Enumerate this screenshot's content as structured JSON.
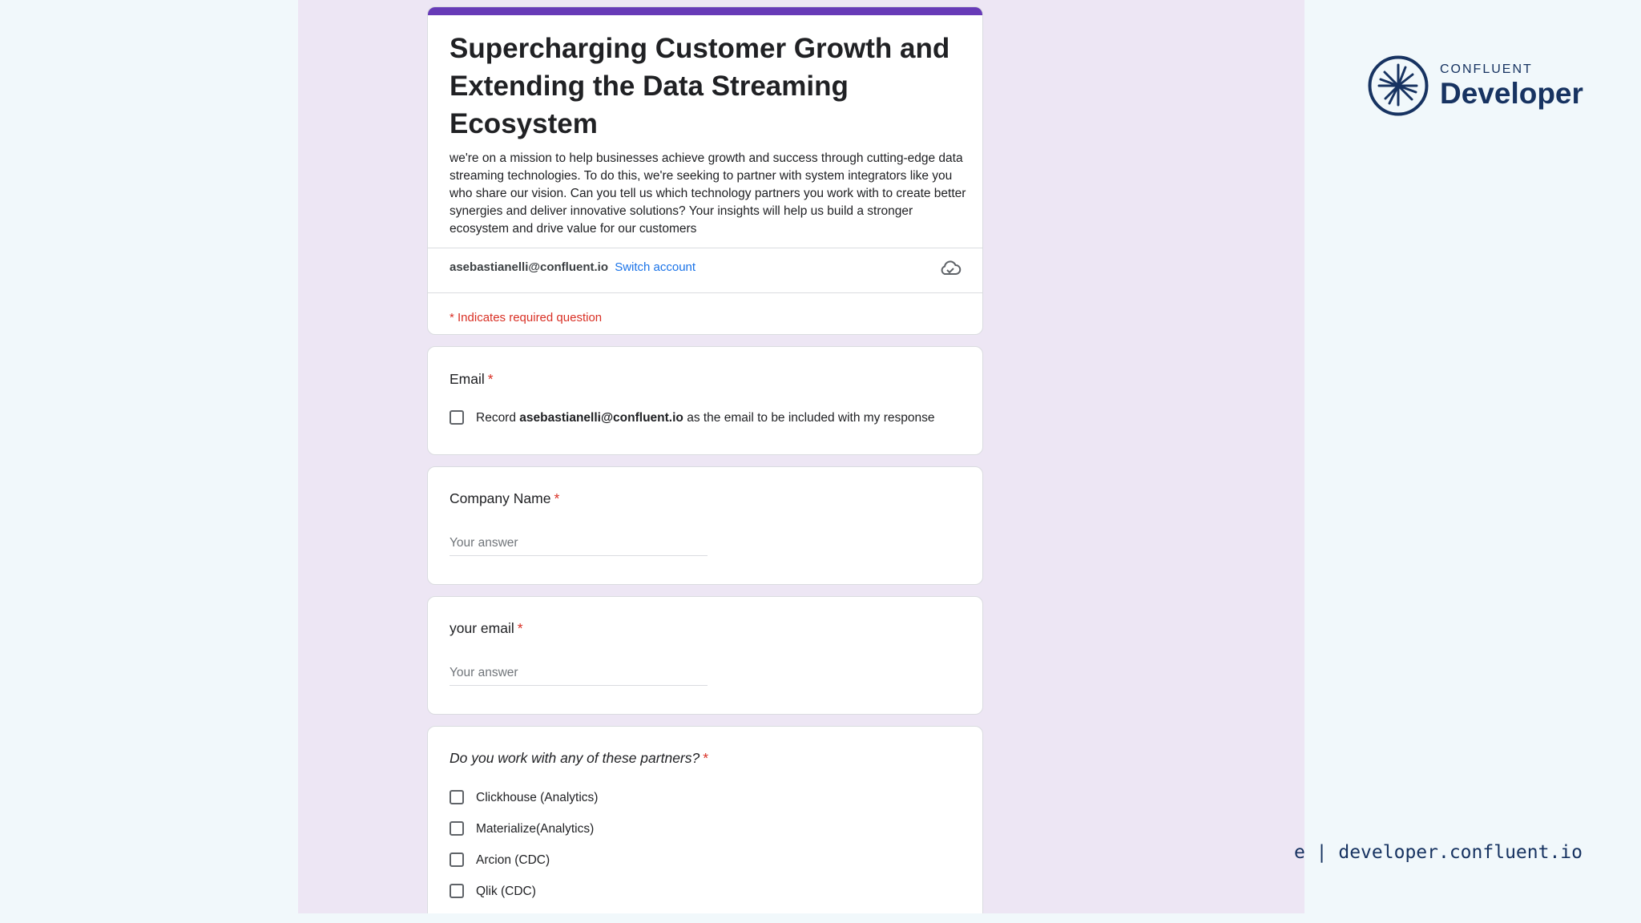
{
  "form": {
    "title": "Supercharging Customer Growth and Extending the Data Streaming Ecosystem",
    "description": "we're on a mission to help businesses achieve growth and success through cutting-edge data streaming technologies. To do this, we're seeking to partner with system integrators like you who share our vision. Can you tell us which technology partners you work with to create better synergies and deliver innovative solutions? Your insights will help us build a stronger ecosystem and drive value for our customers",
    "account_email": "asebastianelli@confluent.io",
    "switch_account": "Switch account",
    "required_note": "* Indicates required question",
    "accent_color": "#673ab7"
  },
  "questions": {
    "email": {
      "label": "Email",
      "star": "*",
      "record_prefix": "Record",
      "record_email": "asebastianelli@confluent.io",
      "record_suffix": "as the email to be included with my response"
    },
    "company": {
      "label": "Company Name",
      "star": "*",
      "placeholder": "Your answer"
    },
    "your_email": {
      "label": "your email",
      "star": "*",
      "placeholder": "Your answer"
    },
    "partners": {
      "label": "Do you work with any of these partners?",
      "star": "*",
      "options": [
        "Clickhouse (Analytics)",
        "Materialize(Analytics)",
        "Arcion (CDC)",
        "Qlik (CDC)"
      ]
    }
  },
  "branding": {
    "brand_small": "CONFLUENT",
    "brand_big": "Developer",
    "footer": "e | developer.confluent.io",
    "logo_icon": "confluent-starburst-logo"
  }
}
